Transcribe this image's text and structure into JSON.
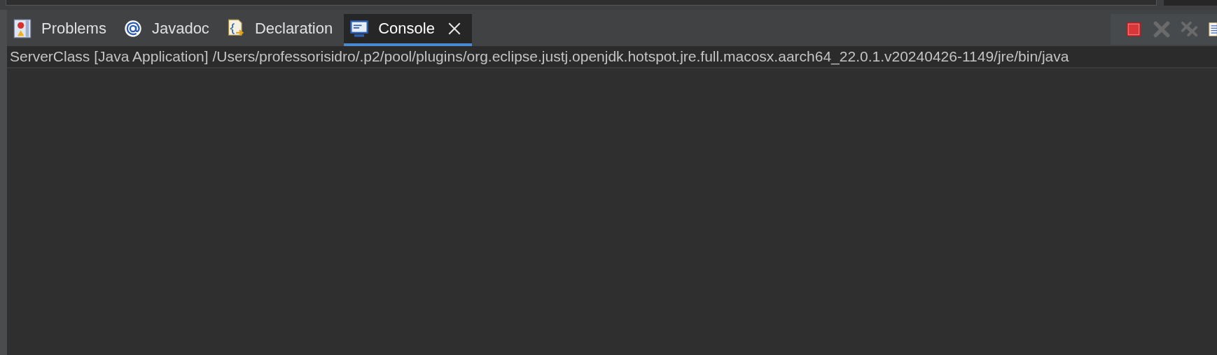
{
  "tabs": [
    {
      "label": "Problems",
      "kind": "problems",
      "selected": false
    },
    {
      "label": "Javadoc",
      "kind": "javadoc",
      "selected": false
    },
    {
      "label": "Declaration",
      "kind": "declaration",
      "selected": false
    },
    {
      "label": "Console",
      "kind": "console",
      "selected": true
    }
  ],
  "toolbar": [
    {
      "kind": "terminate",
      "disabled": false
    },
    {
      "kind": "remove",
      "disabled": true
    },
    {
      "kind": "remove-all",
      "disabled": true
    },
    {
      "kind": "document",
      "disabled": false
    }
  ],
  "console": {
    "header": "ServerClass [Java Application] /Users/professorisidro/.p2/pool/plugins/org.eclipse.justj.openjdk.hotspot.jre.full.macosx.aarch64_22.0.1.v20240426-1149/jre/bin/java"
  }
}
